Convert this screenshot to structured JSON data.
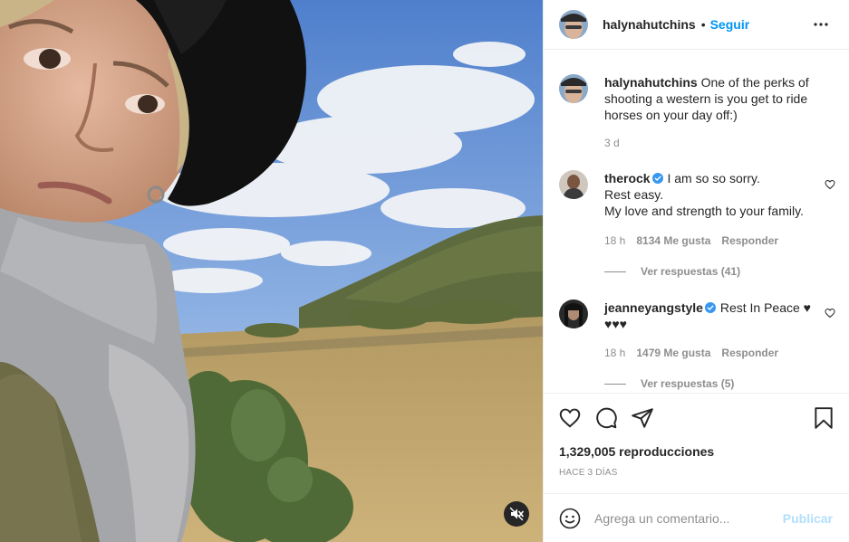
{
  "colors": {
    "link_blue": "#0095f6",
    "publish_disabled": "#b2dffc",
    "secondary_text": "#8e8e8e",
    "primary_text": "#262626",
    "verified_badge": "#3897f0"
  },
  "media": {
    "type": "video",
    "mute_icon": "speaker-muted-icon"
  },
  "header": {
    "username": "halynahutchins",
    "separator": "•",
    "follow_label": "Seguir",
    "more_icon": "more-options-icon"
  },
  "caption": {
    "username": "halynahutchins",
    "text": "One of the perks of shooting a western is you get to ride horses on your day off:)",
    "time": "3 d"
  },
  "comments": [
    {
      "username": "therock",
      "verified": true,
      "lines": [
        "I am so so sorry.",
        "Rest easy.",
        "My love and strength to your family."
      ],
      "time": "18 h",
      "likes": "8134 Me gusta",
      "reply_label": "Responder",
      "view_replies": "Ver respuestas (41)"
    },
    {
      "username": "jeanneyangstyle",
      "verified": true,
      "lines": [
        "Rest In Peace ♥",
        "♥♥♥"
      ],
      "time": "18 h",
      "likes": "1479 Me gusta",
      "reply_label": "Responder",
      "view_replies": "Ver respuestas (5)"
    }
  ],
  "actions": {
    "icons": [
      "heart-icon",
      "comment-icon",
      "share-icon",
      "bookmark-icon"
    ],
    "views": "1,329,005 reproducciones",
    "posted_ago": "HACE 3 DÍAS"
  },
  "add_comment": {
    "placeholder": "Agrega un comentario...",
    "publish_label": "Publicar"
  }
}
